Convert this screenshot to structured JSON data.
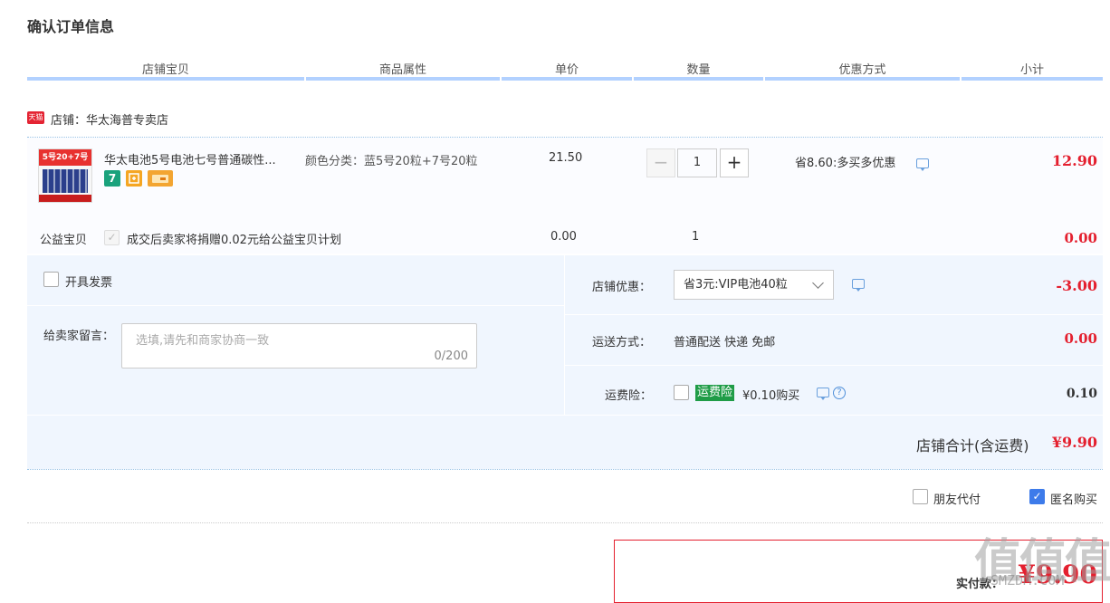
{
  "page_title": "确认订单信息",
  "columns": [
    "店铺宝贝",
    "商品属性",
    "单价",
    "数量",
    "优惠方式",
    "小计"
  ],
  "shop": {
    "tag": "天猫",
    "label": "店铺：华太海普专卖店"
  },
  "item": {
    "name": "华太电池5号电池七号普通碳性...",
    "thumb_text": "5号20+7号20",
    "badges": [
      "7",
      "",
      ""
    ],
    "attr": "颜色分类：蓝5号20粒+7号20粒",
    "unit_price": "21.50",
    "quantity": "1",
    "promo": "省8.60:多买多优惠",
    "subtotal": "12.90",
    "minus": "−",
    "plus": "+"
  },
  "charity": {
    "label": "公益宝贝",
    "text": "成交后卖家将捐赠0.02元给公益宝贝计划",
    "price": "0.00",
    "quantity": "1",
    "subtotal": "0.00",
    "check_mark": "✓"
  },
  "invoice": {
    "label": "开具发票"
  },
  "message": {
    "label": "给卖家留言：",
    "placeholder": "选填,请先和商家协商一致",
    "counter": "0/200"
  },
  "shop_discount": {
    "label": "店铺优惠：",
    "selected": "省3元:VIP电池40粒",
    "amount": "-3.00"
  },
  "shipping": {
    "label": "运送方式：",
    "value": "普通配送 快递 免邮",
    "amount": "0.00"
  },
  "insurance": {
    "label": "运费险：",
    "tag": "运费险",
    "text": "¥0.10购买",
    "help": "?",
    "amount": "0.10"
  },
  "shop_total": {
    "label": "店铺合计(含运费)",
    "value": "¥9.90"
  },
  "options": {
    "friend_pay": "朋友代付",
    "anonymous": "匿名购买",
    "check_mark": "✓"
  },
  "payment": {
    "label": "实付款：",
    "value": "¥9.90"
  },
  "watermark": {
    "main": "值值值",
    "sub": "SMZDM.COM"
  },
  "colors": {
    "accent_red": "#e4202f",
    "header_bar": "#b2d1ff",
    "section_bg": "#f0f6fe",
    "insurance_green": "#1f9c47"
  }
}
